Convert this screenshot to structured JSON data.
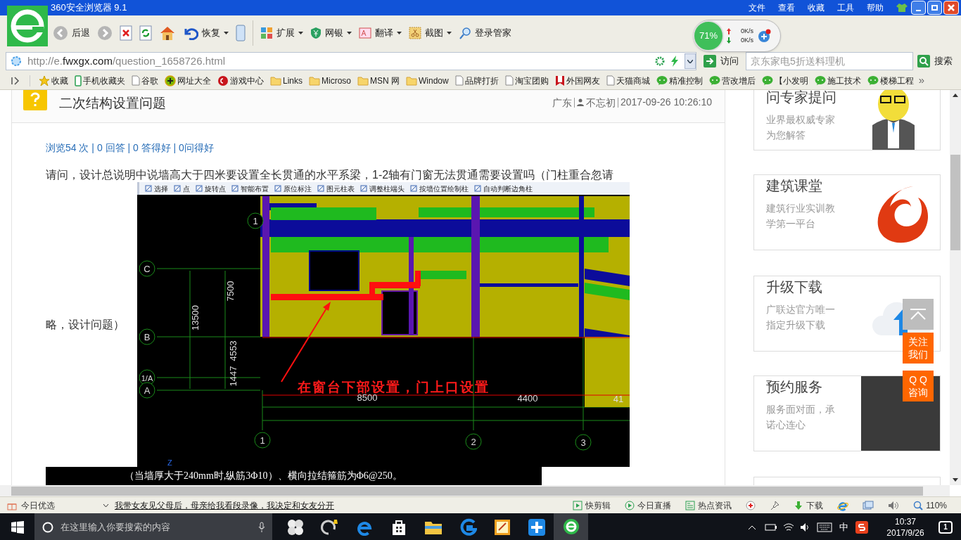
{
  "browser": {
    "title": "360安全浏览器 9.1",
    "menu": [
      "文件",
      "查看",
      "收藏",
      "工具",
      "帮助"
    ],
    "toolbar": [
      {
        "kind": "back",
        "label": "后退"
      },
      {
        "kind": "forward"
      },
      {
        "kind": "stop"
      },
      {
        "kind": "refresh"
      },
      {
        "kind": "home"
      },
      {
        "kind": "restore",
        "label": "恢复",
        "dropdown": true
      },
      {
        "kind": "mobile"
      },
      {
        "kind": "apps",
        "label": "扩展",
        "dropdown": true
      },
      {
        "kind": "bank",
        "label": "网银",
        "dropdown": true
      },
      {
        "kind": "translate",
        "label": "翻译",
        "dropdown": true
      },
      {
        "kind": "scissors",
        "label": "截图",
        "dropdown": true
      },
      {
        "kind": "key",
        "label": "登录管家"
      }
    ],
    "meter": {
      "percent": "71%",
      "up": "0K/s",
      "down": "0K/s"
    },
    "address": "http://e.**fwxgx.com**/question_1658726.html",
    "go_label": "访问",
    "search_placeholder": "京东家电5折送料理机",
    "search_button": "搜索",
    "bookmarks": [
      {
        "kind": "star",
        "label": "收藏"
      },
      {
        "kind": "phone",
        "label": "手机收藏夹"
      },
      {
        "kind": "page",
        "label": "谷歌"
      },
      {
        "kind": "plus",
        "label": "网址大全"
      },
      {
        "kind": "game",
        "label": "游戏中心"
      },
      {
        "kind": "folder",
        "label": "Links"
      },
      {
        "kind": "folder",
        "label": "Microso"
      },
      {
        "kind": "folder",
        "label": "MSN 网"
      },
      {
        "kind": "folder",
        "label": "Window"
      },
      {
        "kind": "page",
        "label": "品牌打折"
      },
      {
        "kind": "page",
        "label": "淘宝团购"
      },
      {
        "kind": "flag",
        "label": "外国网友"
      },
      {
        "kind": "page",
        "label": "天猫商城"
      },
      {
        "kind": "chat",
        "label": "精准控制"
      },
      {
        "kind": "chat",
        "label": "营改增后"
      },
      {
        "kind": "chat",
        "label": "【小发明"
      },
      {
        "kind": "chat",
        "label": "施工技术"
      },
      {
        "kind": "chat",
        "label": "楼梯工程"
      }
    ],
    "more": "»"
  },
  "question": {
    "title": "二次结构设置问题",
    "location": "广东",
    "author": "不忘初",
    "time": "2017-09-26 10:26:10",
    "stats": "浏览54 次 | 0 回答 | 0 答得好 | 0问得好",
    "body_start": "请问，设计总说明中说墙高大于四米要设置全长贯通的水平系梁，1-2轴有门窗无法贯通需要设置吗（门柱重合忽请",
    "body_end": "略，设计问题）"
  },
  "cad": {
    "toolbar": [
      "选择",
      "点",
      "旋转点",
      "智能布置",
      "原位标注",
      "图元柱表",
      "调整柱端头",
      "按墙位置绘制柱",
      "自动判断边角柱"
    ],
    "axes": [
      "1",
      "C",
      "B",
      "1/A",
      "A",
      "1",
      "2",
      "3"
    ],
    "dims": [
      "7500",
      "13500",
      "4553",
      "1447",
      "8500",
      "4400",
      "41"
    ],
    "annotation": "在窗台下部设置，门上口设置",
    "axis_indicator": "Z",
    "note": "（当墙厚大于240mm时,纵筋3Φ10）、横向拉结箍筋为Φ6@250。"
  },
  "sidebar": [
    {
      "kind": "mascot",
      "title": "问专家提问",
      "desc": "业界最权威专家为您解答"
    },
    {
      "kind": "logo",
      "title": "建筑课堂",
      "desc": "建筑行业实训教学第一平台"
    },
    {
      "kind": "cloud",
      "title": "升级下载",
      "desc": "广联达官方唯一指定升级下载"
    },
    {
      "kind": "photo",
      "title": "预约服务",
      "desc": "服务面对面，承诺心连心"
    }
  ],
  "float_buttons": [
    {
      "kind": "top"
    },
    {
      "kind": "text",
      "label": "关注我们"
    },
    {
      "kind": "text",
      "label": "Q Q 咨询"
    }
  ],
  "status_bar": {
    "left": "今日优选",
    "headline": "我带女友见父母后，母亲给我看段录像，我决定和女友分开",
    "items": [
      {
        "kind": "clip",
        "label": "快剪辑"
      },
      {
        "kind": "live",
        "label": "今日直播"
      },
      {
        "kind": "news",
        "label": "热点资讯"
      },
      {
        "kind": "medic"
      },
      {
        "kind": "pin"
      },
      {
        "kind": "download",
        "label": "下载"
      },
      {
        "kind": "ie"
      },
      {
        "kind": "window"
      },
      {
        "kind": "sound"
      },
      {
        "kind": "zoom",
        "label": "110%"
      }
    ]
  },
  "taskbar": {
    "search_placeholder": "在这里输入你要搜索的内容",
    "apps": [
      {
        "kind": "fan",
        "selected": false
      },
      {
        "kind": "swirl",
        "selected": false
      },
      {
        "kind": "edge",
        "selected": false
      },
      {
        "kind": "store",
        "selected": false
      },
      {
        "kind": "folder",
        "selected": false
      },
      {
        "kind": "g",
        "selected": false
      },
      {
        "kind": "notes",
        "selected": false
      },
      {
        "kind": "cross",
        "selected": false
      },
      {
        "kind": "browser",
        "selected": true
      }
    ],
    "ime": "中",
    "time": "10:37",
    "date": "2017/9/26",
    "notifications": "1"
  }
}
